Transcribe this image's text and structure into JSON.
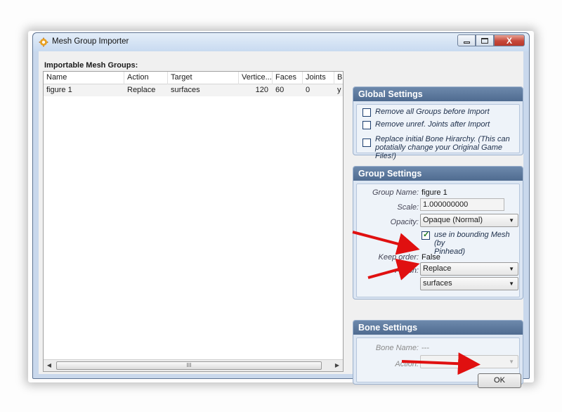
{
  "window": {
    "title": "Mesh Group Importer"
  },
  "mesh_list": {
    "label": "Importable Mesh Groups:",
    "columns": [
      "Name",
      "Action",
      "Target",
      "Vertice...",
      "Faces",
      "Joints",
      "B"
    ],
    "rows": [
      {
        "name": "figure 1",
        "action": "Replace",
        "target": "surfaces",
        "vertices": "120",
        "faces": "60",
        "joints": "0",
        "b": "y"
      }
    ],
    "scroll_thumb_glyph": "III"
  },
  "global_settings": {
    "title": "Global Settings",
    "remove_groups": {
      "label": "Remove all Groups before Import",
      "checked": false
    },
    "remove_joints": {
      "label": "Remove unref. Joints after Import",
      "checked": false
    },
    "replace_bone": {
      "label_line1": "Replace initial Bone  Hirarchy. (This can",
      "label_line2": "potatially change your Original Game Files!)",
      "checked": false
    }
  },
  "group_settings": {
    "title": "Group Settings",
    "group_name_label": "Group Name:",
    "group_name_value": "figure 1",
    "scale_label": "Scale:",
    "scale_value": "1.000000000",
    "opacity_label": "Opacity:",
    "opacity_value": "Opaque (Normal)",
    "bounding_line1": "use in bounding Mesh (by",
    "bounding_line2": "Pinhead)",
    "bounding_checked": true,
    "keep_order_label": "Keep order:",
    "keep_order_value": "False",
    "action_label": "Action:",
    "action_value": "Replace",
    "target_value": "surfaces"
  },
  "bone_settings": {
    "title": "Bone Settings",
    "bone_name_label": "Bone Name:",
    "bone_name_value": "---",
    "action_label": "Action:",
    "action_value": ""
  },
  "buttons": {
    "ok": "OK",
    "close_glyph": "X"
  },
  "colors": {
    "annotation_arrow": "#e01010",
    "panel_header": "#5b7699",
    "close_button": "#c7483a"
  }
}
